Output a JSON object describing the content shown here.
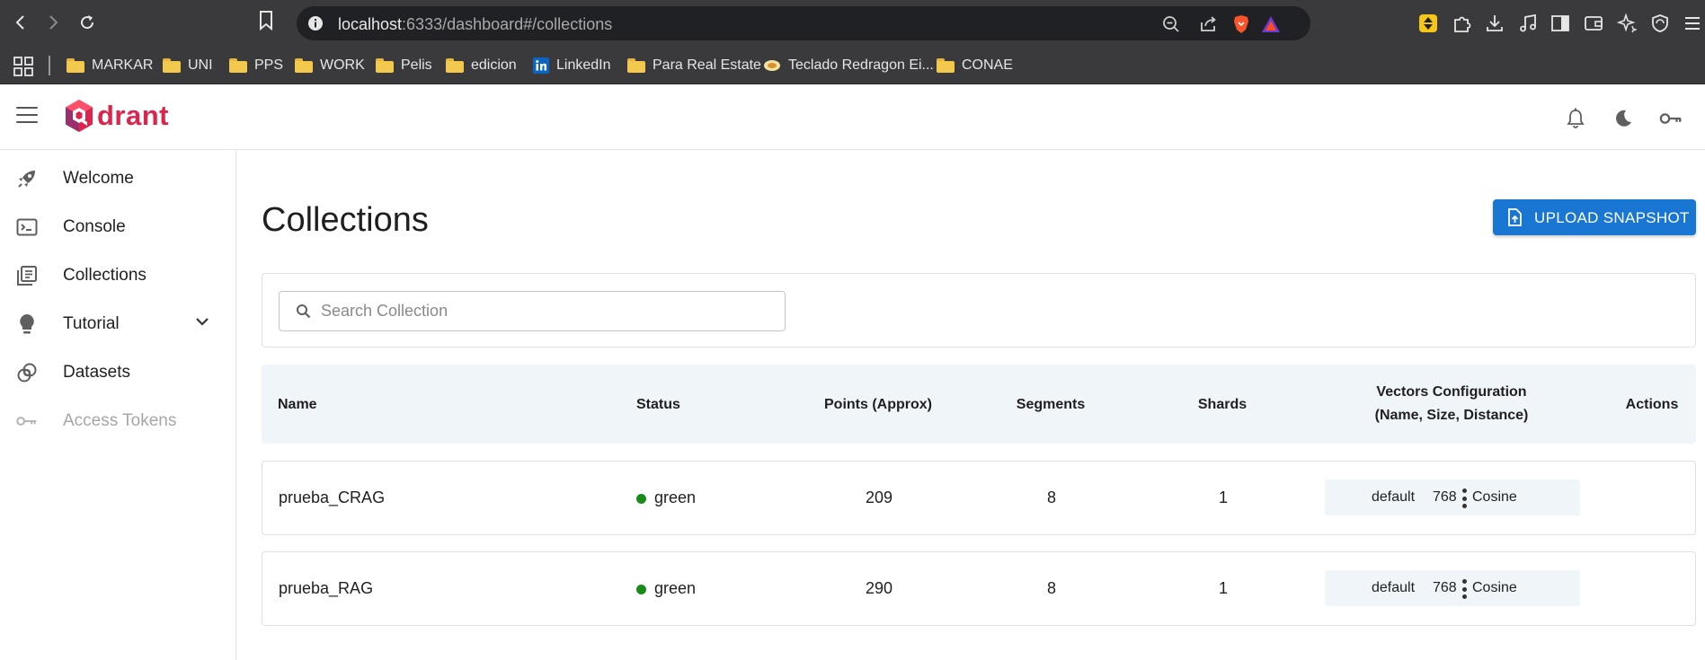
{
  "browser": {
    "url_host": "localhost",
    "url_rest": ":6333/dashboard#/collections",
    "bookmarks": [
      {
        "label": "MARKAR",
        "icon": "folder-icon"
      },
      {
        "label": "UNI",
        "icon": "folder-icon"
      },
      {
        "label": "PPS",
        "icon": "folder-icon"
      },
      {
        "label": "WORK",
        "icon": "folder-icon"
      },
      {
        "label": "Pelis",
        "icon": "folder-icon"
      },
      {
        "label": "edicion",
        "icon": "folder-icon"
      },
      {
        "label": "LinkedIn",
        "icon": "linkedin-icon"
      },
      {
        "label": "Para Real Estate",
        "icon": "folder-icon"
      },
      {
        "label": "Teclado Redragon Ei...",
        "icon": "keyboard-site-icon"
      },
      {
        "label": "CONAE",
        "icon": "folder-icon"
      }
    ]
  },
  "app": {
    "logo_text": "drant",
    "brand_color": "#dc244c",
    "accent_color": "#1976d2"
  },
  "sidebar": {
    "items": [
      {
        "label": "Welcome",
        "icon": "rocket-icon",
        "disabled": false
      },
      {
        "label": "Console",
        "icon": "terminal-icon",
        "disabled": false
      },
      {
        "label": "Collections",
        "icon": "library-books-icon",
        "disabled": false
      },
      {
        "label": "Tutorial",
        "icon": "lightbulb-icon",
        "disabled": false,
        "expandable": true
      },
      {
        "label": "Datasets",
        "icon": "datasets-icon",
        "disabled": false
      },
      {
        "label": "Access Tokens",
        "icon": "key-icon",
        "disabled": true
      }
    ]
  },
  "main": {
    "title": "Collections",
    "upload_button": "UPLOAD SNAPSHOT",
    "search_placeholder": "Search Collection",
    "table": {
      "headers": {
        "name": "Name",
        "status": "Status",
        "points": "Points (Approx)",
        "segments": "Segments",
        "shards": "Shards",
        "vectors_line1": "Vectors Configuration",
        "vectors_line2": "(Name, Size, Distance)",
        "actions": "Actions"
      },
      "rows": [
        {
          "name": "prueba_CRAG",
          "status": "green",
          "status_color": "#1a8a1a",
          "points": "209",
          "segments": "8",
          "shards": "1",
          "vector_name": "default",
          "vector_size": "768",
          "vector_distance": "Cosine"
        },
        {
          "name": "prueba_RAG",
          "status": "green",
          "status_color": "#1a8a1a",
          "points": "290",
          "segments": "8",
          "shards": "1",
          "vector_name": "default",
          "vector_size": "768",
          "vector_distance": "Cosine"
        }
      ]
    }
  }
}
